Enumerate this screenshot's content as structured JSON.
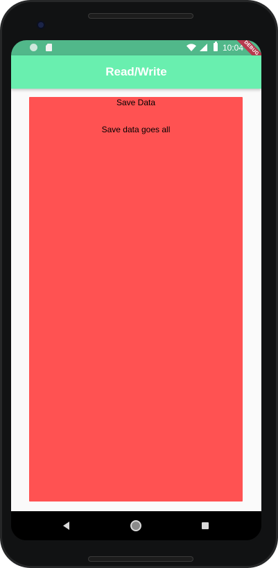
{
  "status_bar": {
    "time": "10:04",
    "icons": [
      "circle-notification-icon",
      "sd-card-icon",
      "wifi-icon",
      "signal-icon",
      "battery-icon"
    ]
  },
  "debug_banner": {
    "label": "DEBUG"
  },
  "app_bar": {
    "title": "Read/Write",
    "color": "#69efaf"
  },
  "card": {
    "title": "Save Data",
    "body": "Save data goes all",
    "color": "#ff5252"
  },
  "nav_bar": {
    "icons": [
      "back-icon",
      "home-icon",
      "recents-icon"
    ]
  }
}
